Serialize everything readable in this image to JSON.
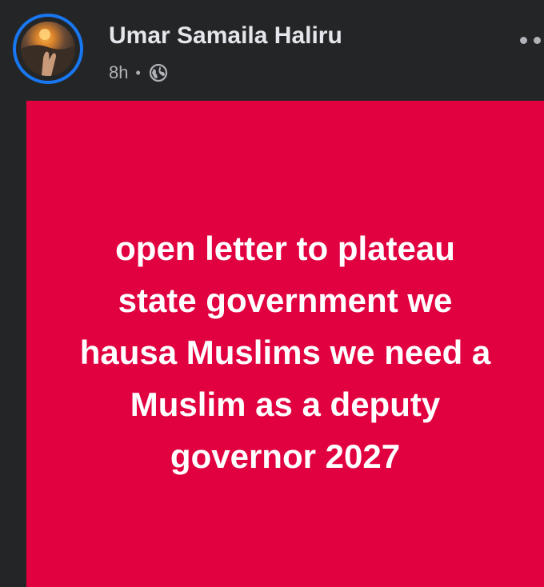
{
  "post": {
    "author": "Umar Samaila Haliru",
    "timestamp": "8h",
    "separator": "•",
    "audience_icon": "globe-icon",
    "more_icon": "more-options-icon",
    "text_lines": [
      "open letter to plateau",
      "state government we",
      "hausa Muslims we need a",
      "Muslim as a deputy",
      "governor 2027"
    ]
  },
  "colors": {
    "background": "#242526",
    "post_background": "#e10040",
    "avatar_ring": "#1877f2",
    "name_text": "#e4e6eb",
    "meta_text": "#b0b3b8",
    "post_text": "#ffffff"
  }
}
